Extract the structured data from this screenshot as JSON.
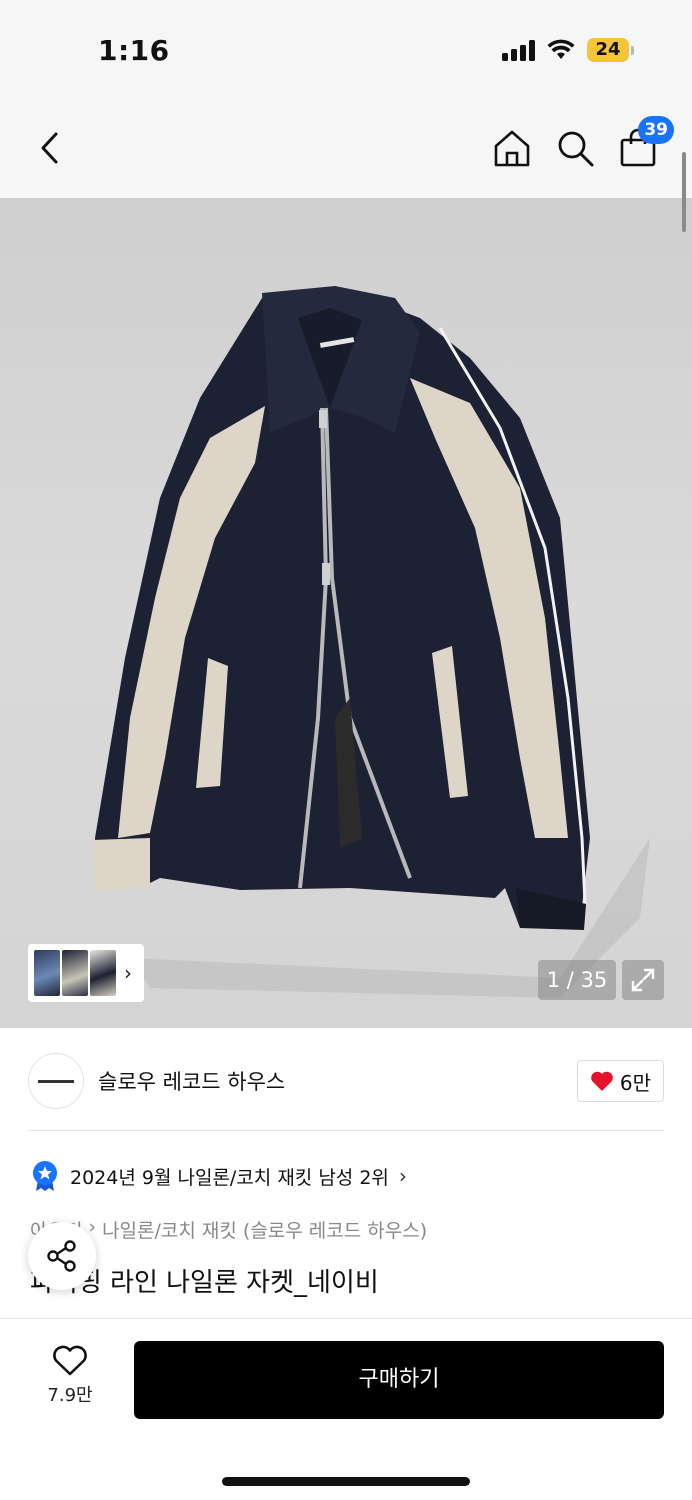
{
  "status_bar": {
    "time": "1:16",
    "battery": "24",
    "icons": [
      "signal-icon",
      "wifi-icon",
      "battery-icon"
    ]
  },
  "header": {
    "back_icon": "back-arrow-icon",
    "home_icon": "home-icon",
    "search_icon": "search-icon",
    "cart_icon": "cart-bag-icon",
    "cart_count": "39"
  },
  "gallery": {
    "counter": "1 / 35",
    "current": 1,
    "total": 35,
    "expand_icon": "expand-icon",
    "thumb_chevron": "›"
  },
  "brand": {
    "name": "슬로우 레코드 하우스",
    "like_count": "6만",
    "like_icon": "heart-filled-icon"
  },
  "ranking": {
    "text": "2024년 9월 나일론/코치 재킷 남성 2위",
    "chevron": "›",
    "badge_icon": "rank-star-badge-icon"
  },
  "breadcrumb": {
    "root": "아우터",
    "separator": "›",
    "category": "나일론/코치 재킷 (슬로우 레코드 하우스)"
  },
  "product": {
    "title": "파이핑 라인 나일론 자켓_네이비"
  },
  "bottom_bar": {
    "wish_count": "7.9만",
    "wish_icon": "heart-outline-icon",
    "buy_label": "구매하기",
    "share_icon": "share-icon"
  },
  "colors": {
    "badge_blue": "#1a73ff",
    "heart_red": "#e8112d",
    "buy_button": "#000000",
    "jacket_navy": "#1c2233",
    "jacket_cream": "#ddd6c8"
  }
}
